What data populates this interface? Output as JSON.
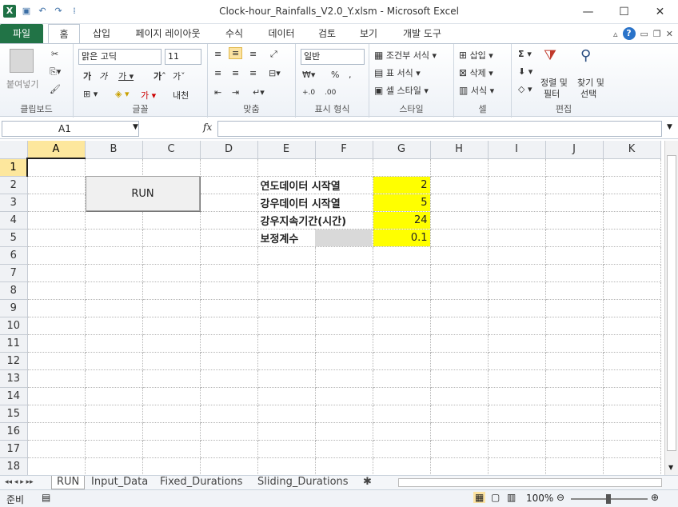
{
  "title": "Clock-hour_Rainfalls_V2.0_Y.xlsm  -  Microsoft Excel",
  "tabs": [
    "파일",
    "홈",
    "삽입",
    "페이지 레이아웃",
    "수식",
    "데이터",
    "검토",
    "보기",
    "개발 도구"
  ],
  "ribbon": {
    "clipboard": {
      "paste": "붙여넣기",
      "label": "클립보드"
    },
    "font": {
      "name": "맑은 고딕",
      "size": "11",
      "label": "글꼴"
    },
    "align": {
      "label": "맞춤"
    },
    "number": {
      "format": "일반",
      "label": "표시 형식"
    },
    "style": {
      "cond": "조건부 서식",
      "table": "표 서식",
      "cell": "셀 스타일",
      "label": "스타일"
    },
    "cells": {
      "insert": "삽입",
      "delete": "삭제",
      "format": "서식",
      "label": "셀"
    },
    "edit": {
      "sort": "정렬 및",
      "filter": "필터",
      "find": "찾기 및",
      "select": "선택",
      "label": "편집"
    }
  },
  "namebox": "A1",
  "fx": "fx",
  "columns": [
    "A",
    "B",
    "C",
    "D",
    "E",
    "F",
    "G",
    "H",
    "I",
    "J",
    "K"
  ],
  "rows": [
    "1",
    "2",
    "3",
    "4",
    "5",
    "6",
    "7",
    "8",
    "9",
    "10",
    "11",
    "12",
    "13",
    "14",
    "15",
    "16",
    "17",
    "18"
  ],
  "run_button": "RUN",
  "params": [
    {
      "label": "연도데이터 시작열",
      "value": "2"
    },
    {
      "label": "강우데이터 시작열",
      "value": "5"
    },
    {
      "label": "강우지속기간(시간)",
      "value": "24"
    },
    {
      "label": "보정계수",
      "value": "0.1"
    }
  ],
  "sheets": [
    "RUN",
    "Input_Data",
    "Fixed_Durations",
    "Sliding_Durations"
  ],
  "status": {
    "ready": "준비",
    "zoom": "100%"
  }
}
